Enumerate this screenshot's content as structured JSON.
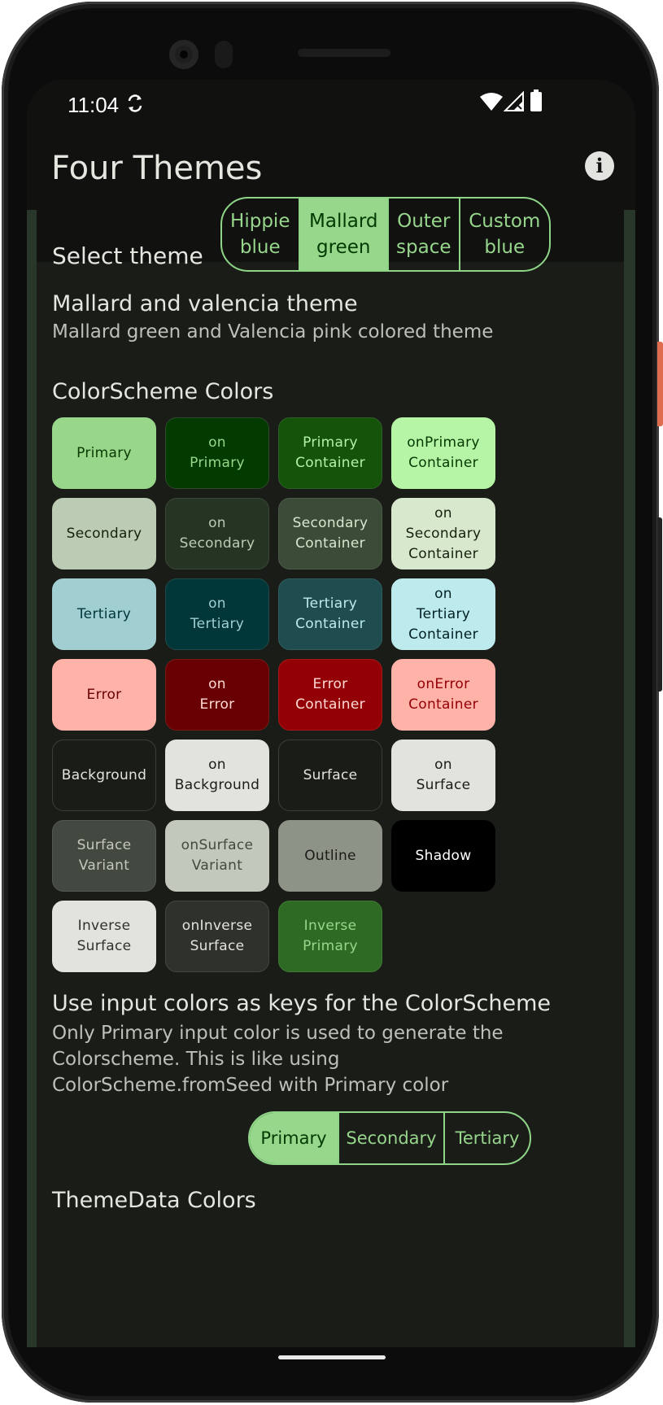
{
  "status_bar": {
    "time": "11:04"
  },
  "app_bar": {
    "title": "Four Themes"
  },
  "theme_select": {
    "label": "Select theme",
    "options": [
      "Hippie\nblue",
      "Mallard\ngreen",
      "Outer\nspace",
      "Custom\nblue"
    ],
    "selected": "Mallard\ngreen"
  },
  "theme_info": {
    "title": "Mallard and valencia theme",
    "description": "Mallard green and Valencia pink colored theme"
  },
  "colorscheme": {
    "heading": "ColorScheme Colors",
    "swatches": [
      {
        "label": "Primary",
        "bg": "#98d78a",
        "fg": "#0a3900",
        "border": "#98d78a"
      },
      {
        "label": "on\nPrimary",
        "bg": "#023a00",
        "fg": "#98d78a",
        "border": "#2e4a2a"
      },
      {
        "label": "Primary\nContainer",
        "bg": "#15520a",
        "fg": "#b4f3a5",
        "border": "#2f5f28"
      },
      {
        "label": "onPrimary\nContainer",
        "bg": "#b6f4a6",
        "fg": "#063a00",
        "border": "#b6f4a6"
      },
      {
        "label": "Secondary",
        "bg": "#bccbb3",
        "fg": "#16200f",
        "border": "#bccbb3"
      },
      {
        "label": "on\nSecondary",
        "bg": "#263423",
        "fg": "#bccbb3",
        "border": "#3a4637"
      },
      {
        "label": "Secondary\nContainer",
        "bg": "#3c4a38",
        "fg": "#d7e7cd",
        "border": "#4d5a4a"
      },
      {
        "label": "on\nSecondary\nContainer",
        "bg": "#d8e8cd",
        "fg": "#17210f",
        "border": "#d8e8cd"
      },
      {
        "label": "Tertiary",
        "bg": "#a1ced0",
        "fg": "#00363a",
        "border": "#a1ced0"
      },
      {
        "label": "on\nTertiary",
        "bg": "#023739",
        "fg": "#a1ced0",
        "border": "#1f4a4c"
      },
      {
        "label": "Tertiary\nContainer",
        "bg": "#1f4d4f",
        "fg": "#bdebed",
        "border": "#2f5d5f"
      },
      {
        "label": "on\nTertiary\nContainer",
        "bg": "#bdeaec",
        "fg": "#002022",
        "border": "#bdeaec"
      },
      {
        "label": "Error",
        "bg": "#ffb3a8",
        "fg": "#680003",
        "border": "#ffb3a8"
      },
      {
        "label": "on\nError",
        "bg": "#680003",
        "fg": "#ffdad4",
        "border": "#7a1a16"
      },
      {
        "label": "Error\nContainer",
        "bg": "#930006",
        "fg": "#ffdad4",
        "border": "#a31a16"
      },
      {
        "label": "onError\nContainer",
        "bg": "#ffb3a8",
        "fg": "#930006",
        "border": "#ffb3a8"
      },
      {
        "label": "Background",
        "bg": "#1a1c18",
        "fg": "#e3e3dc",
        "border": "#3b3f38"
      },
      {
        "label": "on\nBackground",
        "bg": "#e3e3dd",
        "fg": "#1a1c18",
        "border": "#e3e3dd"
      },
      {
        "label": "Surface",
        "bg": "#1a1c18",
        "fg": "#e3e3dc",
        "border": "#3b3f38"
      },
      {
        "label": "on\nSurface",
        "bg": "#e3e3dd",
        "fg": "#1a1c18",
        "border": "#e3e3dd"
      },
      {
        "label": "Surface\nVariant",
        "bg": "#434940",
        "fg": "#c3c8bb",
        "border": "#545a51"
      },
      {
        "label": "onSurface\nVariant",
        "bg": "#c3c8bc",
        "fg": "#424940",
        "border": "#c3c8bc"
      },
      {
        "label": "Outline",
        "bg": "#8d9387",
        "fg": "#1a1c18",
        "border": "#8d9387"
      },
      {
        "label": "Shadow",
        "bg": "#000000",
        "fg": "#ffffff",
        "border": "#000000"
      },
      {
        "label": "Inverse\nSurface",
        "bg": "#e3e3dd",
        "fg": "#2f312d",
        "border": "#e3e3dd"
      },
      {
        "label": "onInverse\nSurface",
        "bg": "#2f312d",
        "fg": "#e3e3dd",
        "border": "#444741"
      },
      {
        "label": "Inverse\nPrimary",
        "bg": "#2e6a24",
        "fg": "#98d78a",
        "border": "#3e7a34"
      }
    ]
  },
  "input_keys": {
    "title": "Use input colors as keys for the ColorScheme",
    "description": "Only Primary input color is used to generate the Colorscheme. This is like using ColorScheme.fromSeed with Primary color",
    "options": [
      "Primary",
      "Secondary",
      "Tertiary"
    ],
    "selected": "Primary"
  },
  "themedata": {
    "heading": "ThemeData Colors"
  },
  "colors": {
    "accent": "#98d78a",
    "background": "#1a1c18",
    "appbar": "#111210"
  }
}
